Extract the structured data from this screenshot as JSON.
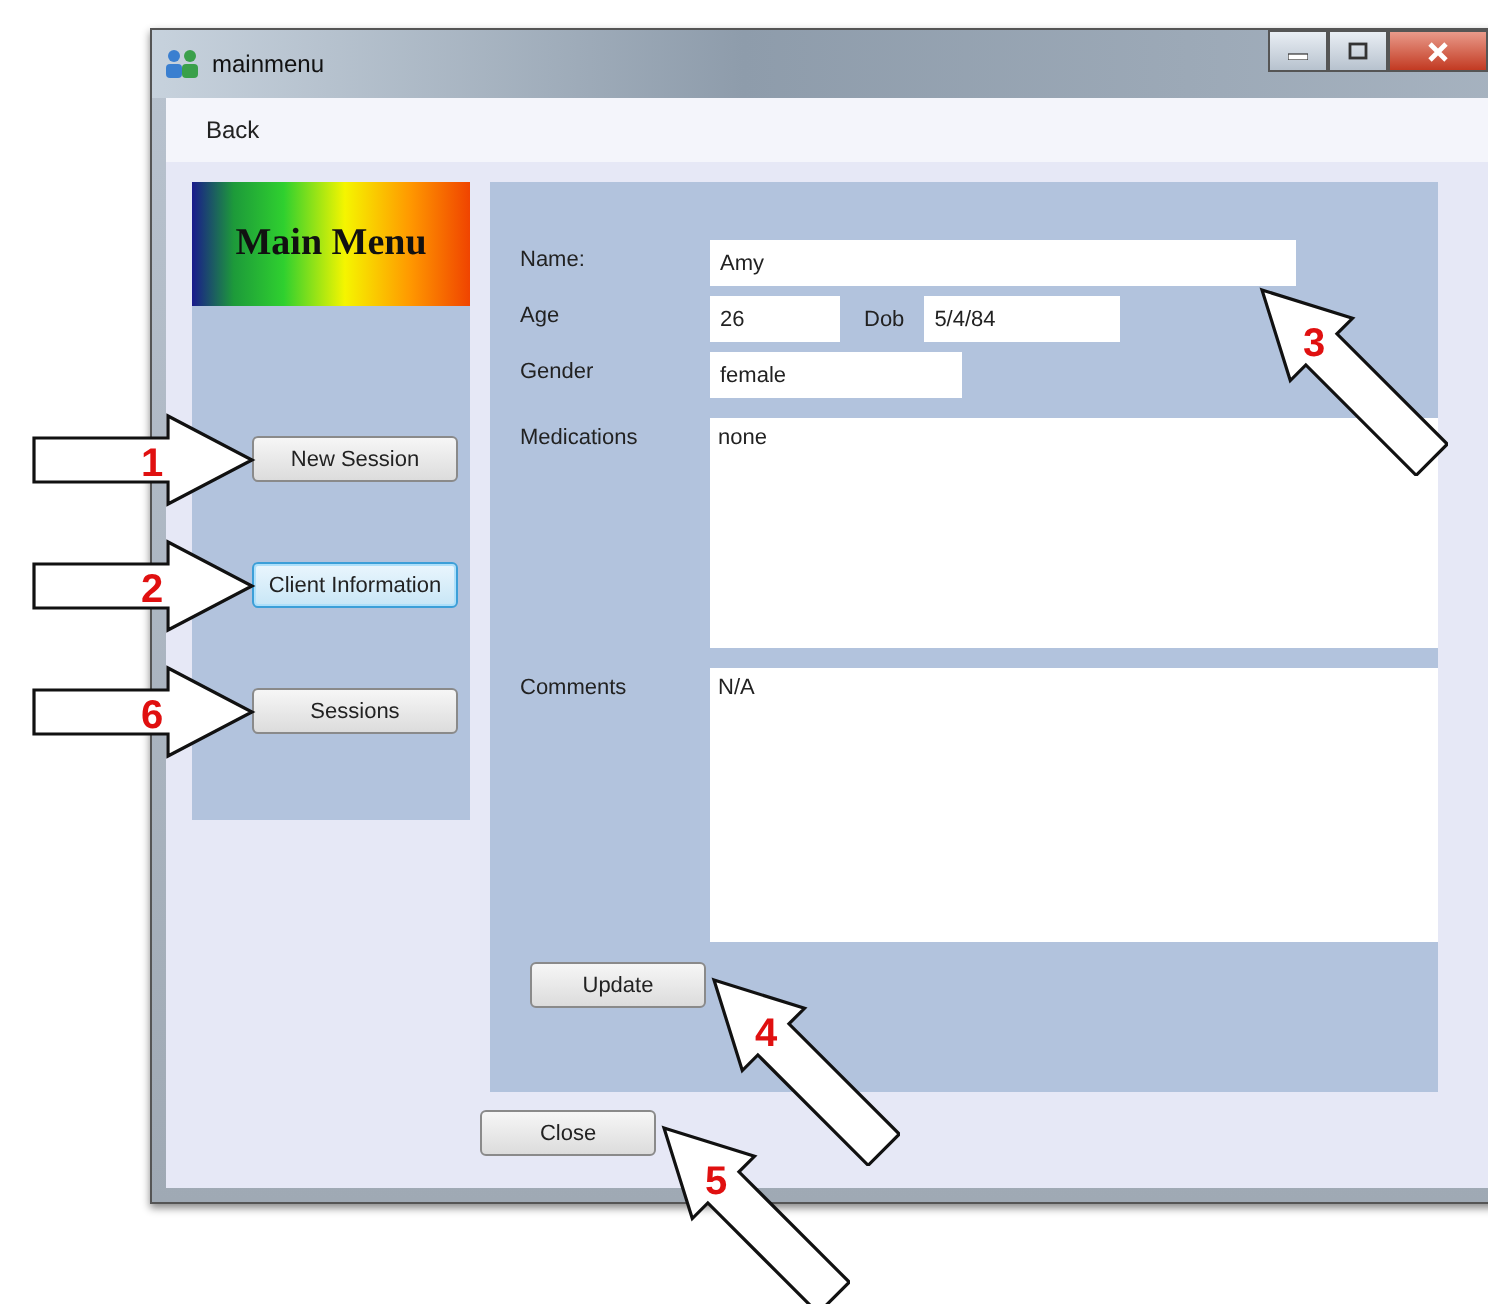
{
  "window": {
    "title": "mainmenu"
  },
  "menu": [
    "Back"
  ],
  "logo": {
    "title": "Main Menu"
  },
  "nav_buttons": [
    {
      "label": "New Session",
      "focused": false,
      "callout": "1"
    },
    {
      "label": "Client Information",
      "focused": true,
      "callout": "2"
    },
    {
      "label": "Sessions",
      "focused": false,
      "callout": "6"
    }
  ],
  "form": {
    "name": {
      "label": "Name:",
      "value": "Amy",
      "callout": "3"
    },
    "age": {
      "label": "Age",
      "value": "26"
    },
    "dob": {
      "label": "Dob",
      "value": "5/4/84"
    },
    "gender": {
      "label": "Gender",
      "value": "female"
    },
    "medications": {
      "label": "Medications",
      "value": "none"
    },
    "comments": {
      "label": "Comments",
      "value": "N/A"
    },
    "update_button": {
      "label": "Update",
      "callout": "4"
    }
  },
  "close_button": {
    "label": "Close",
    "callout": "5"
  }
}
